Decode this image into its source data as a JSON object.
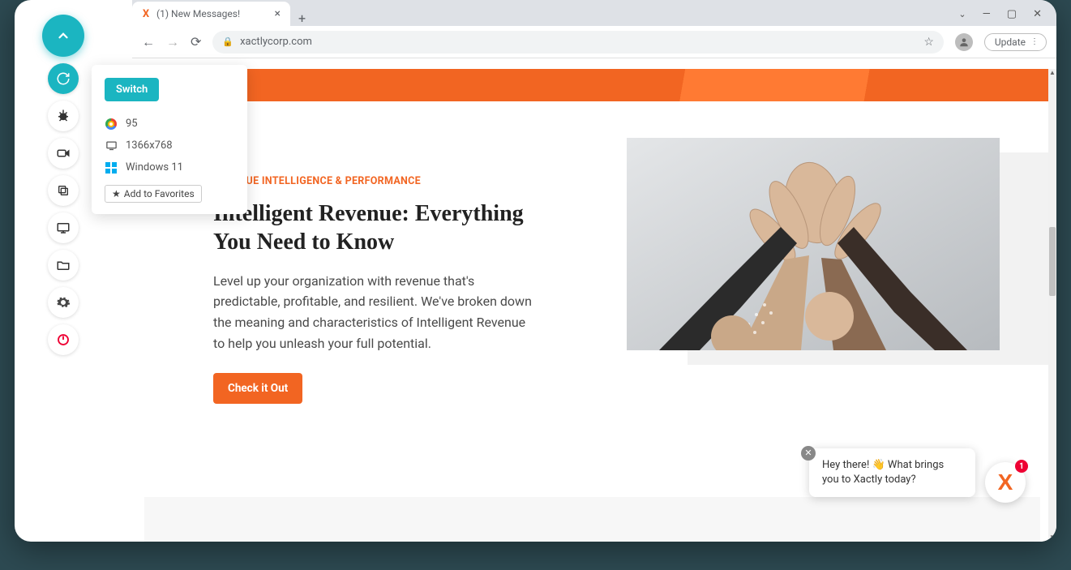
{
  "browser": {
    "tab_title": "(1) New Messages!",
    "url_display": "xactlycorp.com",
    "update_label": "Update"
  },
  "sidebar": {
    "icons": [
      "chevron-up",
      "sync",
      "bug",
      "video",
      "copy",
      "display",
      "folder",
      "gear",
      "power"
    ]
  },
  "popover": {
    "switch_label": "Switch",
    "browser_version": "95",
    "resolution": "1366x768",
    "os": "Windows 11",
    "favorites_label": "Add to Favorites"
  },
  "page": {
    "eyebrow": "REVENUE INTELLIGENCE & PERFORMANCE",
    "headline": "Intelligent Revenue: Everything You Need to Know",
    "body": "Level up your organization with revenue that's predictable, profitable, and resilient. We've broken down the meaning and characteristics of Intelligent Revenue to help you unleash your full potential.",
    "cta_label": "Check it Out"
  },
  "chat": {
    "message": "Hey there! 👋 What brings you to Xactly today?",
    "badge": "1"
  }
}
